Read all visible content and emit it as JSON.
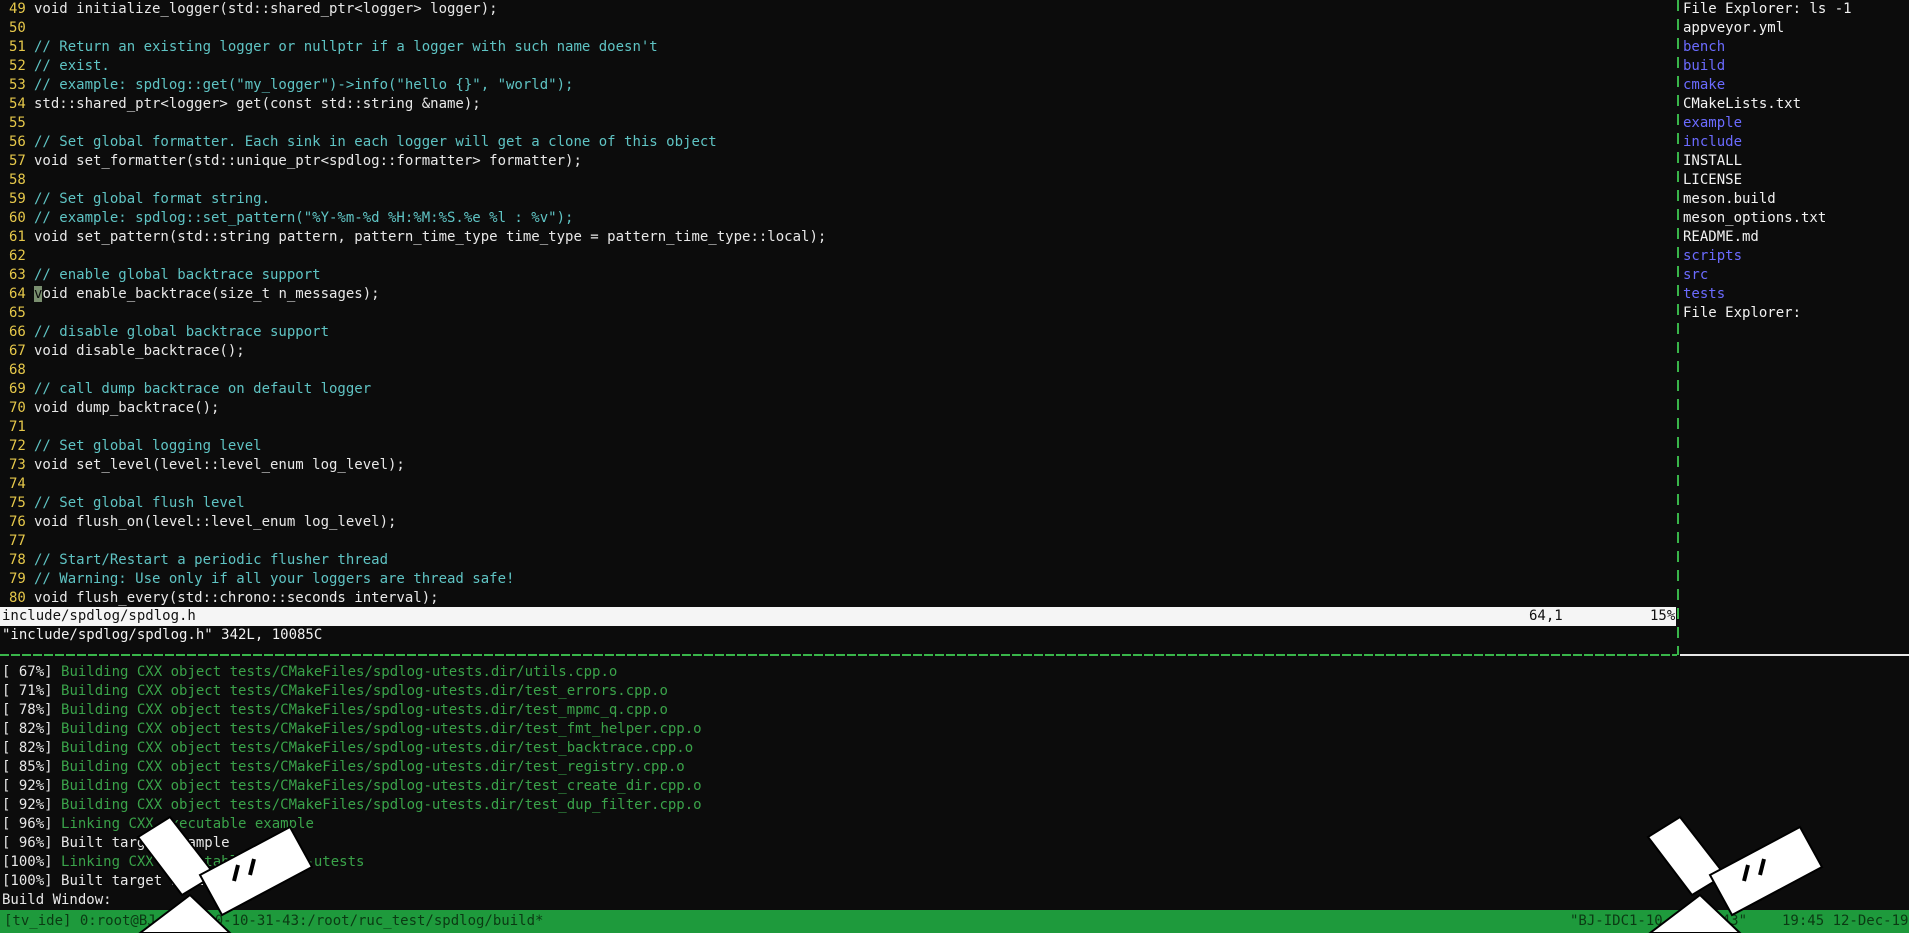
{
  "editor": {
    "lines": [
      {
        "n": "49",
        "kind": "code",
        "text": "void initialize_logger(std::shared_ptr<logger> logger);"
      },
      {
        "n": "50",
        "kind": "code",
        "text": ""
      },
      {
        "n": "51",
        "kind": "comment",
        "text": "// Return an existing logger or nullptr if a logger with such name doesn't"
      },
      {
        "n": "52",
        "kind": "comment",
        "text": "// exist."
      },
      {
        "n": "53",
        "kind": "comment",
        "text": "// example: spdlog::get(\"my_logger\")->info(\"hello {}\", \"world\");"
      },
      {
        "n": "54",
        "kind": "code",
        "text": "std::shared_ptr<logger> get(const std::string &name);"
      },
      {
        "n": "55",
        "kind": "code",
        "text": ""
      },
      {
        "n": "56",
        "kind": "comment",
        "text": "// Set global formatter. Each sink in each logger will get a clone of this object"
      },
      {
        "n": "57",
        "kind": "code",
        "text": "void set_formatter(std::unique_ptr<spdlog::formatter> formatter);"
      },
      {
        "n": "58",
        "kind": "code",
        "text": ""
      },
      {
        "n": "59",
        "kind": "comment",
        "text": "// Set global format string."
      },
      {
        "n": "60",
        "kind": "comment",
        "text": "// example: spdlog::set_pattern(\"%Y-%m-%d %H:%M:%S.%e %l : %v\");"
      },
      {
        "n": "61",
        "kind": "code",
        "text": "void set_pattern(std::string pattern, pattern_time_type time_type = pattern_time_type::local);"
      },
      {
        "n": "62",
        "kind": "code",
        "text": ""
      },
      {
        "n": "63",
        "kind": "comment",
        "text": "// enable global backtrace support"
      },
      {
        "n": "64",
        "kind": "cursor",
        "text": "void enable_backtrace(size_t n_messages);"
      },
      {
        "n": "65",
        "kind": "code",
        "text": ""
      },
      {
        "n": "66",
        "kind": "comment",
        "text": "// disable global backtrace support"
      },
      {
        "n": "67",
        "kind": "code",
        "text": "void disable_backtrace();"
      },
      {
        "n": "68",
        "kind": "code",
        "text": ""
      },
      {
        "n": "69",
        "kind": "comment",
        "text": "// call dump backtrace on default logger"
      },
      {
        "n": "70",
        "kind": "code",
        "text": "void dump_backtrace();"
      },
      {
        "n": "71",
        "kind": "code",
        "text": ""
      },
      {
        "n": "72",
        "kind": "comment",
        "text": "// Set global logging level"
      },
      {
        "n": "73",
        "kind": "code",
        "text": "void set_level(level::level_enum log_level);"
      },
      {
        "n": "74",
        "kind": "code",
        "text": ""
      },
      {
        "n": "75",
        "kind": "comment",
        "text": "// Set global flush level"
      },
      {
        "n": "76",
        "kind": "code",
        "text": "void flush_on(level::level_enum log_level);"
      },
      {
        "n": "77",
        "kind": "code",
        "text": ""
      },
      {
        "n": "78",
        "kind": "comment",
        "text": "// Start/Restart a periodic flusher thread"
      },
      {
        "n": "79",
        "kind": "comment",
        "text": "// Warning: Use only if all your loggers are thread safe!"
      },
      {
        "n": "80",
        "kind": "code",
        "text": "void flush_every(std::chrono::seconds interval);"
      }
    ],
    "status": {
      "filename": "include/spdlog/spdlog.h",
      "position": "64,1",
      "percent": "15%"
    },
    "message": "\"include/spdlog/spdlog.h\" 342L, 10085C"
  },
  "explorer": {
    "title": "File Explorer: ls -1",
    "items": [
      {
        "name": "appveyor.yml",
        "type": "file"
      },
      {
        "name": "bench",
        "type": "dir"
      },
      {
        "name": "build",
        "type": "dir"
      },
      {
        "name": "cmake",
        "type": "dir"
      },
      {
        "name": "CMakeLists.txt",
        "type": "file"
      },
      {
        "name": "example",
        "type": "dir"
      },
      {
        "name": "include",
        "type": "dir"
      },
      {
        "name": "INSTALL",
        "type": "file"
      },
      {
        "name": "LICENSE",
        "type": "file"
      },
      {
        "name": "meson.build",
        "type": "file"
      },
      {
        "name": "meson_options.txt",
        "type": "file"
      },
      {
        "name": "README.md",
        "type": "file"
      },
      {
        "name": "scripts",
        "type": "dir"
      },
      {
        "name": "src",
        "type": "dir"
      },
      {
        "name": "tests",
        "type": "dir"
      }
    ],
    "footer": "File Explorer:"
  },
  "build": {
    "lines": [
      {
        "pct": "[ 67%]",
        "msg": "Building CXX object tests/CMakeFiles/spdlog-utests.dir/utils.cpp.o",
        "color": "green"
      },
      {
        "pct": "[ 71%]",
        "msg": "Building CXX object tests/CMakeFiles/spdlog-utests.dir/test_errors.cpp.o",
        "color": "green"
      },
      {
        "pct": "[ 78%]",
        "msg": "Building CXX object tests/CMakeFiles/spdlog-utests.dir/test_mpmc_q.cpp.o",
        "color": "green"
      },
      {
        "pct": "[ 82%]",
        "msg": "Building CXX object tests/CMakeFiles/spdlog-utests.dir/test_fmt_helper.cpp.o",
        "color": "green"
      },
      {
        "pct": "[ 82%]",
        "msg": "Building CXX object tests/CMakeFiles/spdlog-utests.dir/test_backtrace.cpp.o",
        "color": "green"
      },
      {
        "pct": "[ 85%]",
        "msg": "Building CXX object tests/CMakeFiles/spdlog-utests.dir/test_registry.cpp.o",
        "color": "green"
      },
      {
        "pct": "[ 92%]",
        "msg": "Building CXX object tests/CMakeFiles/spdlog-utests.dir/test_create_dir.cpp.o",
        "color": "green"
      },
      {
        "pct": "[ 92%]",
        "msg": "Building CXX object tests/CMakeFiles/spdlog-utests.dir/test_dup_filter.cpp.o",
        "color": "green"
      },
      {
        "pct": "[ 96%]",
        "msg": "Linking CXX executable example",
        "color": "green"
      },
      {
        "pct": "[ 96%]",
        "msg": "Built target example",
        "color": "white"
      },
      {
        "pct": "[100%]",
        "msg": "Linking CXX executable spdlog-utests",
        "color": "green"
      },
      {
        "pct": "[100%]",
        "msg": "Built target spdlog-utests",
        "color": "white"
      }
    ],
    "title": "Build Window:"
  },
  "tmux": {
    "left": "[tv_ide] 0:root@BJ-IDC1-10-10-31-43:/root/ruc_test/spdlog/build*",
    "host": "\"BJ-IDC1-10-10-31-43\"",
    "clock": "19:45 12-Dec-19"
  },
  "colors": {
    "background": "#0c0c0c",
    "line_number": "#e6c84a",
    "comment": "#5fc4c4",
    "dir": "#6b6bff",
    "build_green": "#3aa34a",
    "tmux_bar": "#1e9a3c"
  }
}
